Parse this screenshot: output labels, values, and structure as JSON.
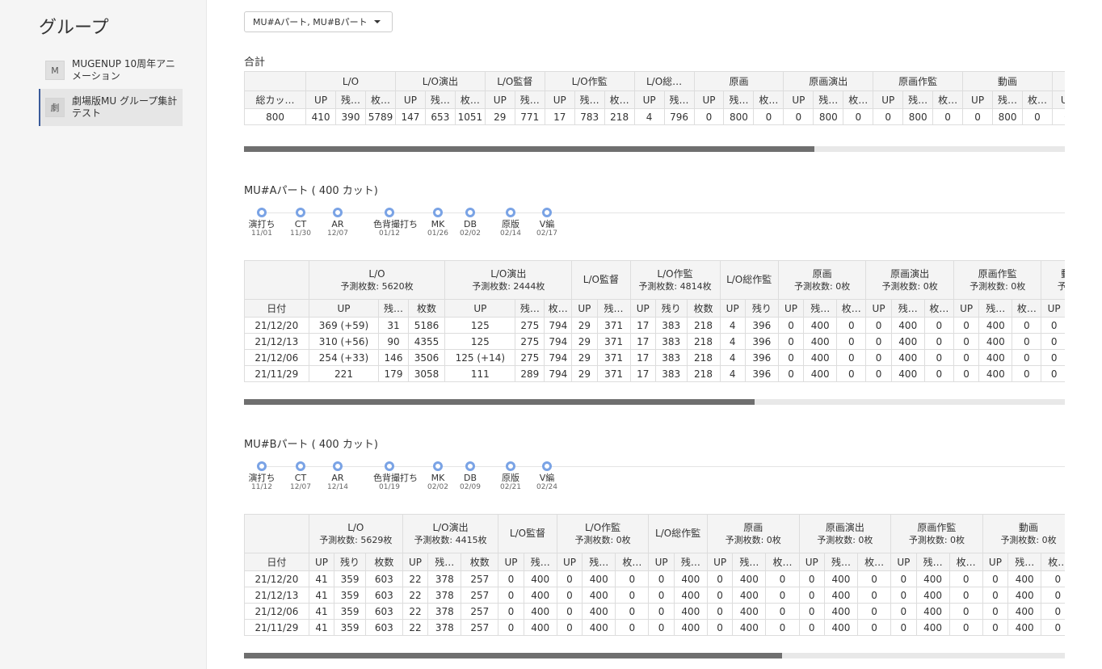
{
  "sidebar": {
    "title": "グループ",
    "items": [
      {
        "avatar": "M",
        "label": "MUGENUP 10周年アニメーション"
      },
      {
        "avatar": "劇",
        "label": "劇場版MU グループ集計テスト"
      }
    ]
  },
  "selector": {
    "value": "MU#Aパート, MU#Bパート"
  },
  "total": {
    "title": "合計",
    "groups": [
      "L/O",
      "L/O演出",
      "L/O監督",
      "L/O作監",
      "L/O総…",
      "原画",
      "原画演出",
      "原画作監",
      "動画",
      "動検"
    ],
    "corner_label": "総カッ…",
    "sub_headers": [
      "UP",
      "残…",
      "枚…",
      "UP",
      "残…",
      "枚…",
      "UP",
      "残…",
      "UP",
      "残…",
      "枚…",
      "UP",
      "残…",
      "UP",
      "残…",
      "枚…",
      "UP",
      "残…",
      "枚…",
      "UP",
      "残…",
      "枚…",
      "UP",
      "残…",
      "枚…",
      "UP",
      "残…"
    ],
    "row": [
      "800",
      "410",
      "390",
      "5789",
      "147",
      "653",
      "1051",
      "29",
      "771",
      "17",
      "783",
      "218",
      "4",
      "796",
      "0",
      "800",
      "0",
      "0",
      "800",
      "0",
      "0",
      "800",
      "0",
      "0",
      "800",
      "0",
      "0",
      "800"
    ]
  },
  "partA": {
    "title": "MU#Aパート ( 400 カット)",
    "milestones": [
      {
        "label": "演打ち",
        "date": "11/01"
      },
      {
        "label": "CT",
        "date": "11/30"
      },
      {
        "label": "AR",
        "date": "12/07"
      },
      {
        "label": "色背撮打ち",
        "date": "01/12"
      },
      {
        "label": "MK",
        "date": "01/26"
      },
      {
        "label": "DB",
        "date": "02/02"
      },
      {
        "label": "原版",
        "date": "02/14"
      },
      {
        "label": "V編",
        "date": "02/17"
      }
    ],
    "groups": [
      {
        "name": "L/O",
        "pred": "予測枚数: 5620枚"
      },
      {
        "name": "L/O演出",
        "pred": "予測枚数: 2444枚"
      },
      {
        "name": "L/O監督",
        "pred": ""
      },
      {
        "name": "L/O作監",
        "pred": "予測枚数: 4814枚"
      },
      {
        "name": "L/O総作監",
        "pred": ""
      },
      {
        "name": "原画",
        "pred": "予測枚数: 0枚"
      },
      {
        "name": "原画演出",
        "pred": "予測枚数: 0枚"
      },
      {
        "name": "原画作監",
        "pred": "予測枚数: 0枚"
      },
      {
        "name": "動画",
        "pred": "予測枚"
      }
    ],
    "date_header": "日付",
    "sub_headers": [
      "UP",
      "残…",
      "枚数",
      "UP",
      "残…",
      "枚…",
      "UP",
      "残…",
      "UP",
      "残り",
      "枚数",
      "UP",
      "残り",
      "UP",
      "残…",
      "枚…",
      "UP",
      "残…",
      "枚…",
      "UP",
      "残…",
      "枚…",
      "UP",
      "残"
    ],
    "rows": [
      [
        "21/12/20",
        "369 (+59)",
        "31",
        "5186",
        "125",
        "275",
        "794",
        "29",
        "371",
        "17",
        "383",
        "218",
        "4",
        "396",
        "0",
        "400",
        "0",
        "0",
        "400",
        "0",
        "0",
        "400",
        "0",
        "0",
        "4"
      ],
      [
        "21/12/13",
        "310 (+56)",
        "90",
        "4355",
        "125",
        "275",
        "794",
        "29",
        "371",
        "17",
        "383",
        "218",
        "4",
        "396",
        "0",
        "400",
        "0",
        "0",
        "400",
        "0",
        "0",
        "400",
        "0",
        "0",
        "4"
      ],
      [
        "21/12/06",
        "254 (+33)",
        "146",
        "3506",
        "125 (+14)",
        "275",
        "794",
        "29",
        "371",
        "17",
        "383",
        "218",
        "4",
        "396",
        "0",
        "400",
        "0",
        "0",
        "400",
        "0",
        "0",
        "400",
        "0",
        "0",
        "4"
      ],
      [
        "21/11/29",
        "221",
        "179",
        "3058",
        "111",
        "289",
        "794",
        "29",
        "371",
        "17",
        "383",
        "218",
        "4",
        "396",
        "0",
        "400",
        "0",
        "0",
        "400",
        "0",
        "0",
        "400",
        "0",
        "0",
        "4"
      ]
    ]
  },
  "partB": {
    "title": "MU#Bパート ( 400 カット)",
    "milestones": [
      {
        "label": "演打ち",
        "date": "11/12"
      },
      {
        "label": "CT",
        "date": "12/07"
      },
      {
        "label": "AR",
        "date": "12/14"
      },
      {
        "label": "色背撮打ち",
        "date": "01/19"
      },
      {
        "label": "MK",
        "date": "02/02"
      },
      {
        "label": "DB",
        "date": "02/09"
      },
      {
        "label": "原版",
        "date": "02/21"
      },
      {
        "label": "V編",
        "date": "02/24"
      }
    ],
    "groups": [
      {
        "name": "L/O",
        "pred": "予測枚数: 5629枚"
      },
      {
        "name": "L/O演出",
        "pred": "予測枚数: 4415枚"
      },
      {
        "name": "L/O監督",
        "pred": ""
      },
      {
        "name": "L/O作監",
        "pred": "予測枚数: 0枚"
      },
      {
        "name": "L/O総作監",
        "pred": ""
      },
      {
        "name": "原画",
        "pred": "予測枚数: 0枚"
      },
      {
        "name": "原画演出",
        "pred": "予測枚数: 0枚"
      },
      {
        "name": "原画作監",
        "pred": "予測枚数: 0枚"
      },
      {
        "name": "動画",
        "pred": "予測枚数: 0枚"
      },
      {
        "name": "動",
        "pred": "子"
      }
    ],
    "date_header": "日付",
    "sub_headers": [
      "UP",
      "残り",
      "枚数",
      "UP",
      "残…",
      "枚数",
      "UP",
      "残…",
      "UP",
      "残…",
      "枚…",
      "UP",
      "残…",
      "UP",
      "残…",
      "枚…",
      "UP",
      "残…",
      "枚…",
      "UP",
      "残…",
      "枚…",
      "UP",
      "残…",
      "枚…",
      "UP"
    ],
    "rows": [
      [
        "21/12/20",
        "41",
        "359",
        "603",
        "22",
        "378",
        "257",
        "0",
        "400",
        "0",
        "400",
        "0",
        "0",
        "400",
        "0",
        "400",
        "0",
        "0",
        "400",
        "0",
        "0",
        "400",
        "0",
        "0",
        "400",
        "0",
        "0"
      ],
      [
        "21/12/13",
        "41",
        "359",
        "603",
        "22",
        "378",
        "257",
        "0",
        "400",
        "0",
        "400",
        "0",
        "0",
        "400",
        "0",
        "400",
        "0",
        "0",
        "400",
        "0",
        "0",
        "400",
        "0",
        "0",
        "400",
        "0",
        "0"
      ],
      [
        "21/12/06",
        "41",
        "359",
        "603",
        "22",
        "378",
        "257",
        "0",
        "400",
        "0",
        "400",
        "0",
        "0",
        "400",
        "0",
        "400",
        "0",
        "0",
        "400",
        "0",
        "0",
        "400",
        "0",
        "0",
        "400",
        "0",
        "0"
      ],
      [
        "21/11/29",
        "41",
        "359",
        "603",
        "22",
        "378",
        "257",
        "0",
        "400",
        "0",
        "400",
        "0",
        "0",
        "400",
        "0",
        "400",
        "0",
        "0",
        "400",
        "0",
        "0",
        "400",
        "0",
        "0",
        "400",
        "0",
        "0"
      ]
    ]
  }
}
